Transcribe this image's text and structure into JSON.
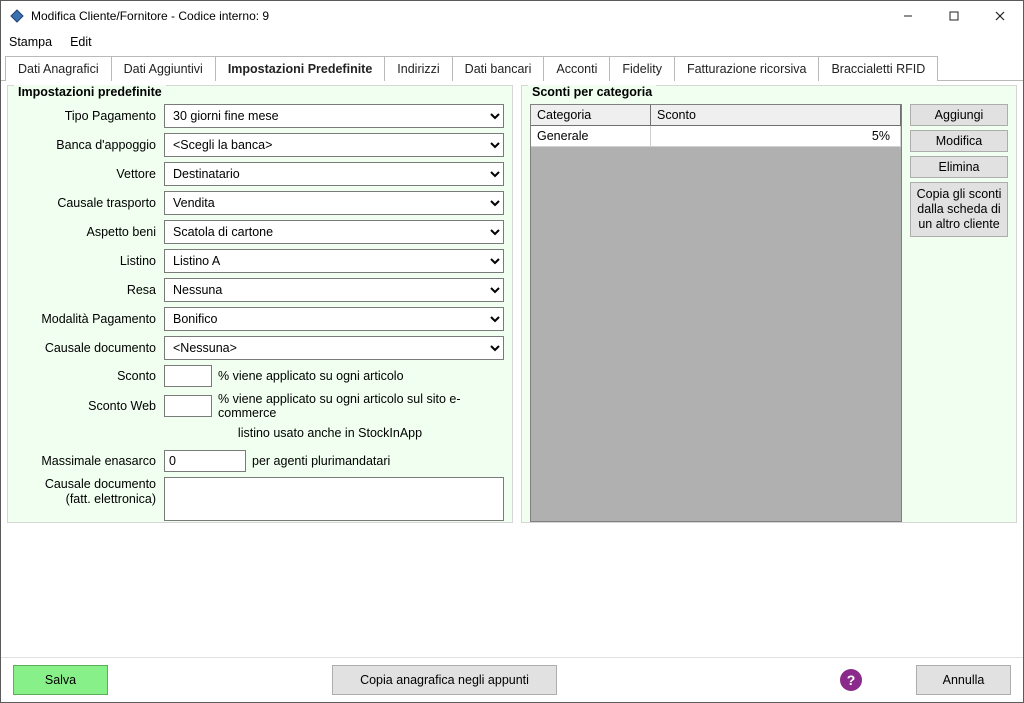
{
  "window": {
    "title": "Modifica Cliente/Fornitore - Codice interno: 9"
  },
  "menu": {
    "stampa": "Stampa",
    "edit": "Edit"
  },
  "tabs": {
    "dati_anagrafici": "Dati Anagrafici",
    "dati_aggiuntivi": "Dati Aggiuntivi",
    "impostazioni_predefinite": "Impostazioni Predefinite",
    "indirizzi": "Indirizzi",
    "dati_bancari": "Dati bancari",
    "acconti": "Acconti",
    "fidelity": "Fidelity",
    "fatturazione_ricorsiva": "Fatturazione ricorsiva",
    "braccialetti_rfid": "Braccialetti RFID"
  },
  "left_panel": {
    "title": "Impostazioni predefinite",
    "rows": {
      "tipo_pagamento": {
        "label": "Tipo Pagamento",
        "value": "30 giorni fine mese"
      },
      "banca_appoggio": {
        "label": "Banca d'appoggio",
        "value": "<Scegli la banca>"
      },
      "vettore": {
        "label": "Vettore",
        "value": "Destinatario"
      },
      "causale_trasporto": {
        "label": "Causale trasporto",
        "value": "Vendita"
      },
      "aspetto_beni": {
        "label": "Aspetto beni",
        "value": "Scatola di cartone"
      },
      "listino": {
        "label": "Listino",
        "value": "Listino A"
      },
      "resa": {
        "label": "Resa",
        "value": "Nessuna"
      },
      "modalita_pagamento": {
        "label": "Modalità Pagamento",
        "value": "Bonifico"
      },
      "causale_documento": {
        "label": "Causale documento",
        "value": "<Nessuna>"
      },
      "sconto": {
        "label": "Sconto",
        "value": "",
        "suffix": "% viene applicato su ogni articolo"
      },
      "sconto_web": {
        "label": "Sconto Web",
        "value": "",
        "suffix": "% viene applicato su ogni articolo sul sito e-commerce"
      },
      "listino_note": "listino usato anche in StockInApp",
      "massimale_enasarco": {
        "label": "Massimale enasarco",
        "value": "0",
        "suffix": "per agenti plurimandatari"
      },
      "causale_doc_fe": {
        "label_line1": "Causale documento",
        "label_line2": "(fatt. elettronica)",
        "value": ""
      }
    }
  },
  "right_panel": {
    "title": "Sconti per categoria",
    "headers": {
      "categoria": "Categoria",
      "sconto": "Sconto"
    },
    "rows": [
      {
        "categoria": "Generale",
        "sconto": "5%"
      }
    ],
    "buttons": {
      "aggiungi": "Aggiungi",
      "modifica": "Modifica",
      "elimina": "Elimina",
      "copia_sconti": "Copia gli sconti dalla scheda di un altro cliente"
    }
  },
  "footer": {
    "salva": "Salva",
    "copia_anagrafica": "Copia anagrafica negli appunti",
    "annulla": "Annulla",
    "help": "?"
  }
}
